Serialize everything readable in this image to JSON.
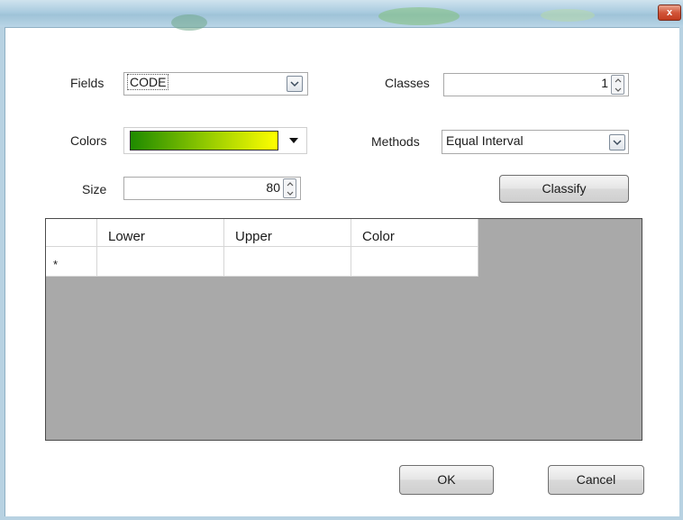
{
  "window": {
    "close_glyph": "x"
  },
  "form": {
    "fields_label": "Fields",
    "fields_value": "CODE",
    "classes_label": "Classes",
    "classes_value": "1",
    "colors_label": "Colors",
    "colors_ramp": {
      "start": "#1e8a00",
      "end": "#ffff00"
    },
    "methods_label": "Methods",
    "methods_value": "Equal Interval",
    "size_label": "Size",
    "size_value": "80",
    "classify_label": "Classify"
  },
  "table": {
    "columns": [
      "Lower",
      "Upper",
      "Color"
    ],
    "new_row_marker": "*",
    "rows": []
  },
  "footer": {
    "ok_label": "OK",
    "cancel_label": "Cancel"
  },
  "colors": {
    "grid_background": "#a9a9a9",
    "titlebar": "#a9cbdf"
  }
}
